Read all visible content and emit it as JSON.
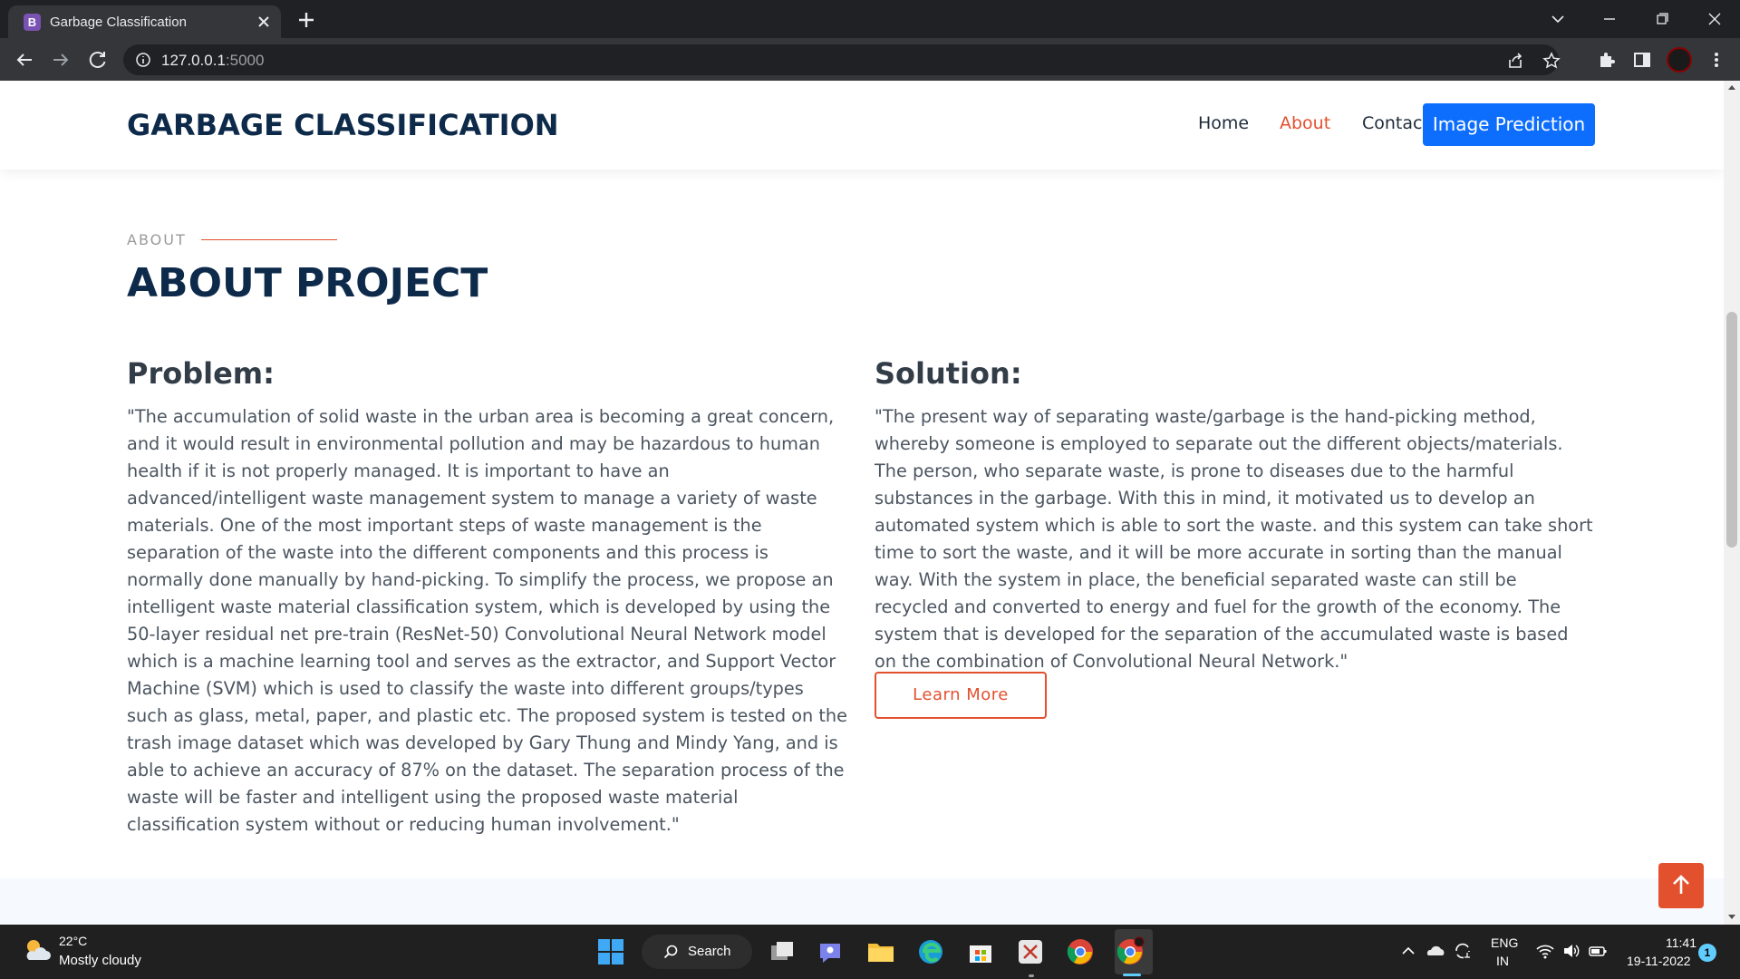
{
  "browser": {
    "tab_title": "Garbage Classification",
    "tab_favicon_letter": "B",
    "url_host": "127.0.0.1",
    "url_port": ":5000"
  },
  "site": {
    "logo": "GARBAGE CLASSIFICATION",
    "nav": {
      "home": "Home",
      "about": "About",
      "contact": "Contact",
      "cta": "Image Prediction"
    },
    "accent_color": "#e3502e",
    "primary_color": "#0d6efd"
  },
  "about": {
    "label": "ABOUT",
    "title": "ABOUT PROJECT",
    "problem_heading": "Problem:",
    "problem_text": "\"The accumulation of solid waste in the urban area is becoming a great concern, and it would result in environmental pollution and may be hazardous to human health if it is not properly managed. It is important to have an advanced/intelligent waste management system to manage a variety of waste materials. One of the most important steps of waste management is the separation of the waste into the different components and this process is normally done manually by hand-picking. To simplify the process, we propose an intelligent waste material classification system, which is developed by using the 50-layer residual net pre-train (ResNet-50) Convolutional Neural Network model which is a machine learning tool and serves as the extractor, and Support Vector Machine (SVM) which is used to classify the waste into different groups/types such as glass, metal, paper, and plastic etc. The proposed system is tested on the trash image dataset which was developed by Gary Thung and Mindy Yang, and is able to achieve an accuracy of 87% on the dataset. The separation process of the waste will be faster and intelligent using the proposed waste material classification system without or reducing human involvement.\"",
    "solution_heading": "Solution:",
    "solution_text": "\"The present way of separating waste/garbage is the hand-picking method, whereby someone is employed to separate out the different objects/materials. The person, who separate waste, is prone to diseases due to the harmful substances in the garbage. With this in mind, it motivated us to develop an automated system which is able to sort the waste. and this system can take short time to sort the waste, and it will be more accurate in sorting than the manual way. With the system in place, the beneficial separated waste can still be recycled and converted to energy and fuel for the growth of the economy. The system that is developed for the separation of the accumulated waste is based on the combination of Convolutional Neural Network.\"",
    "learn_more": "Learn More"
  },
  "taskbar": {
    "weather_temp": "22°C",
    "weather_desc": "Mostly cloudy",
    "search_label": "Search",
    "lang_line1": "ENG",
    "lang_line2": "IN",
    "time": "11:41",
    "date": "19-11-2022",
    "notification_count": "1"
  }
}
